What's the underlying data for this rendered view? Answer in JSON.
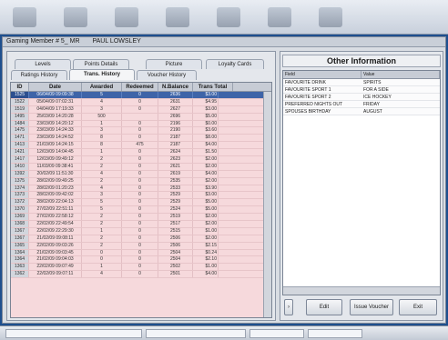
{
  "window": {
    "title": "Gaming Member # 5_ MR",
    "member_name": "PAUL LOWSLEY"
  },
  "tabs": {
    "row1": [
      "Levels",
      "Points Details",
      "Picture",
      "Loyalty Cards"
    ],
    "row2": [
      "Ratings History",
      "Trans. History",
      "Voucher History"
    ],
    "active": "Trans. History"
  },
  "trans_history": {
    "columns": [
      "ID",
      "Date",
      "Awarded",
      "Redeemed",
      "N.Balance",
      "Trans Total"
    ],
    "rows": [
      [
        "1525",
        "06/04/09 09:09:38",
        "5",
        "0",
        "2636",
        "$3.00"
      ],
      [
        "1522",
        "05/04/09 07:02:31",
        "4",
        "0",
        "2631",
        "$4.95"
      ],
      [
        "1519",
        "04/04/09 17:19:33",
        "3",
        "0",
        "2627",
        "$3.00"
      ],
      [
        "1495",
        "25/03/09 14:20:28",
        "500",
        "",
        "2696",
        "$5.00"
      ],
      [
        "1484",
        "23/03/09 14:20:12",
        "1",
        "0",
        "2196",
        "$0.00"
      ],
      [
        "1475",
        "23/03/09 14:24:33",
        "3",
        "0",
        "2190",
        "$3.60"
      ],
      [
        "1471",
        "23/03/09 14:24:52",
        "8",
        "0",
        "2187",
        "$8.00"
      ],
      [
        "1413",
        "21/03/09 14:24:15",
        "8",
        "475",
        "2187",
        "$4.00"
      ],
      [
        "1421",
        "12/03/09 14:04:45",
        "1",
        "0",
        "2624",
        "$1.50"
      ],
      [
        "1417",
        "12/03/09 09:49:12",
        "2",
        "0",
        "2623",
        "$2.00"
      ],
      [
        "1410",
        "11/03/09 09:38:41",
        "2",
        "0",
        "2621",
        "$2.00"
      ],
      [
        "1392",
        "20/02/09 11:51:30",
        "4",
        "0",
        "2619",
        "$4.00"
      ],
      [
        "1375",
        "28/02/09 09:49:25",
        "2",
        "0",
        "2535",
        "$2.00"
      ],
      [
        "1374",
        "28/02/09 01:20:23",
        "4",
        "0",
        "2533",
        "$3.90"
      ],
      [
        "1373",
        "28/02/09 09:42:02",
        "3",
        "0",
        "2529",
        "$3.00"
      ],
      [
        "1372",
        "28/02/09 22:04:13",
        "5",
        "0",
        "2529",
        "$5.00"
      ],
      [
        "1370",
        "27/02/09 22:51:11",
        "5",
        "0",
        "2524",
        "$5.00"
      ],
      [
        "1369",
        "27/02/09 22:58:12",
        "2",
        "0",
        "2519",
        "$2.00"
      ],
      [
        "1368",
        "22/02/09 22:49:54",
        "2",
        "0",
        "2517",
        "$2.00"
      ],
      [
        "1367",
        "22/02/09 22:29:30",
        "1",
        "0",
        "2515",
        "$1.00"
      ],
      [
        "1367",
        "21/02/09 09:08:11",
        "2",
        "0",
        "2506",
        "$2.00"
      ],
      [
        "1365",
        "22/02/09 09:03:26",
        "2",
        "0",
        "2506",
        "$2.15"
      ],
      [
        "1364",
        "21/02/09 09:03:45",
        "0",
        "0",
        "2504",
        "$0.24"
      ],
      [
        "1364",
        "21/02/09 09:04:03",
        "0",
        "0",
        "2504",
        "$2.10"
      ],
      [
        "1363",
        "22/02/09 09:07:49",
        "1",
        "0",
        "2502",
        "$1.00"
      ],
      [
        "1362",
        "22/02/09 09:07:11",
        "4",
        "0",
        "2501",
        "$4.00"
      ]
    ],
    "selected_index": 0
  },
  "other_information": {
    "title": "Other Information",
    "columns": [
      "Field",
      "Value"
    ],
    "rows": [
      [
        "FAVOURITE DRINK",
        "SPIRITS"
      ],
      [
        "FAVOURITE SPORT 1",
        "FOR A SIDE"
      ],
      [
        "FAVOURITE SPORT 2",
        "ICE HOCKEY"
      ],
      [
        "PREFERRED NIGHTS OUT",
        "FRIDAY"
      ],
      [
        "SPOUSES BIRTHDAY",
        "AUGUST"
      ]
    ]
  },
  "buttons": {
    "edit": "Edit",
    "issue_voucher": "Issue Voucher",
    "exit": "Exit"
  },
  "colors": {
    "grid_background": "#f6d9dc",
    "selection": "#3e64a8",
    "desktop": "#1e4f8e"
  },
  "icons": [
    "toolbar-icon-1",
    "toolbar-icon-2",
    "toolbar-icon-3",
    "toolbar-icon-4",
    "toolbar-icon-5",
    "toolbar-icon-6",
    "toolbar-icon-7"
  ]
}
